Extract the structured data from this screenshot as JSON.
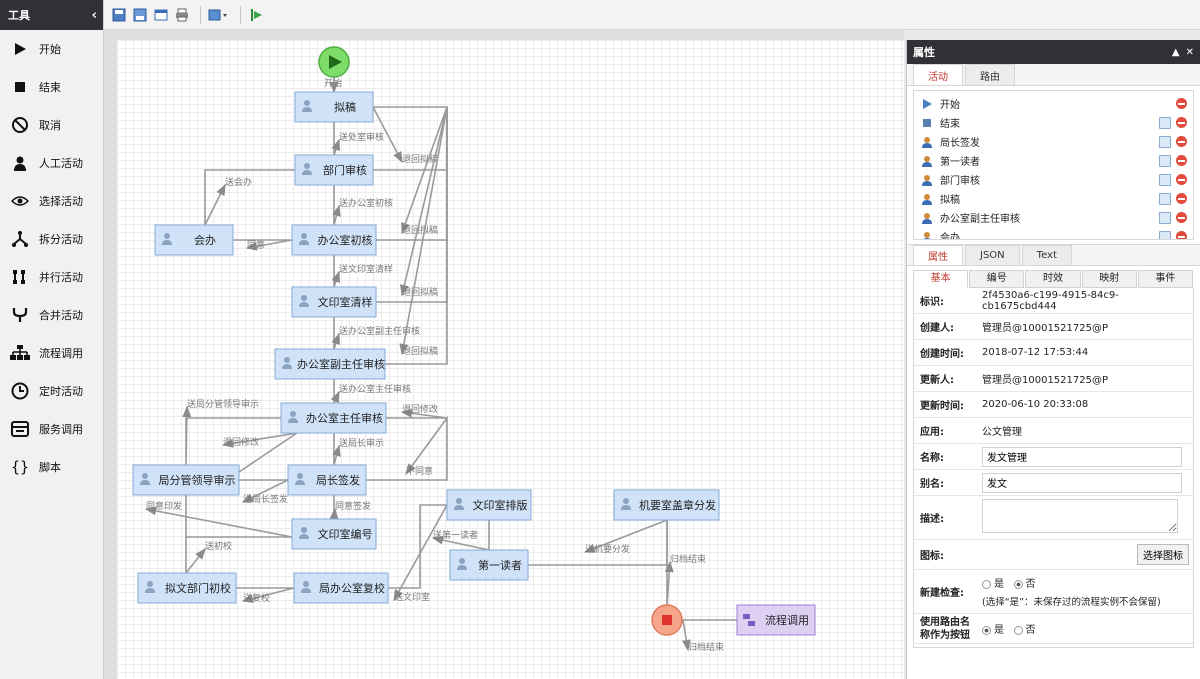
{
  "toolbox": {
    "title": "工具",
    "items": [
      {
        "label": "开始",
        "icon": "play-icon"
      },
      {
        "label": "结束",
        "icon": "stop-icon"
      },
      {
        "label": "取消",
        "icon": "cancel-icon"
      },
      {
        "label": "人工活动",
        "icon": "person-icon"
      },
      {
        "label": "选择活动",
        "icon": "eye-icon"
      },
      {
        "label": "拆分活动",
        "icon": "split-icon"
      },
      {
        "label": "并行活动",
        "icon": "parallel-icon"
      },
      {
        "label": "合并活动",
        "icon": "merge-icon"
      },
      {
        "label": "流程调用",
        "icon": "hierarchy-icon"
      },
      {
        "label": "定时活动",
        "icon": "clock-icon"
      },
      {
        "label": "服务调用",
        "icon": "service-icon"
      },
      {
        "label": "脚本",
        "icon": "script-icon"
      }
    ]
  },
  "flow": {
    "nodes": [
      {
        "label": "拟稿"
      },
      {
        "label": "部门审核"
      },
      {
        "label": "会办"
      },
      {
        "label": "办公室初核"
      },
      {
        "label": "文印室清样"
      },
      {
        "label": "办公室副主任审核"
      },
      {
        "label": "办公室主任审核"
      },
      {
        "label": "局分管领导审示"
      },
      {
        "label": "局长签发"
      },
      {
        "label": "文印室编号"
      },
      {
        "label": "拟文部门初校"
      },
      {
        "label": "局办公室复校"
      },
      {
        "label": "文印室排版"
      },
      {
        "label": "第一读者"
      },
      {
        "label": "机要室盖章分发"
      },
      {
        "label": "流程调用"
      }
    ],
    "start_label": "开始",
    "edge_labels": [
      "送处室审核",
      "退回拟稿",
      "送会办",
      "送办公室初核",
      "退回拟稿",
      "同意",
      "送文印室清样",
      "退回拟稿",
      "送办公室副主任审核",
      "退回拟稿",
      "送办公室主任审核",
      "退回修改",
      "送局分管领导审示",
      "退回修改",
      "送局长审示",
      "送局长签发",
      "不同意",
      "同意印发",
      "同意签发",
      "送初校",
      "送复校",
      "送文印室",
      "送第一读者",
      "送机要分发",
      "归档结束",
      "归档结束"
    ]
  },
  "panel": {
    "title": "属性",
    "top_tabs": [
      "活动",
      "路由"
    ],
    "activities": [
      {
        "name": "开始",
        "kind": "start"
      },
      {
        "name": "结束",
        "kind": "end"
      },
      {
        "name": "局长签发",
        "kind": "person"
      },
      {
        "name": "第一读者",
        "kind": "person"
      },
      {
        "name": "部门审核",
        "kind": "person"
      },
      {
        "name": "拟稿",
        "kind": "person"
      },
      {
        "name": "办公室副主任审核",
        "kind": "person"
      },
      {
        "name": "会办",
        "kind": "person"
      }
    ],
    "mid_tabs": [
      "属性",
      "JSON",
      "Text"
    ],
    "sub_tabs": [
      "基本",
      "编号",
      "时效",
      "映射",
      "事件"
    ],
    "props": {
      "id_label": "标识:",
      "id": "2f4530a6-c199-4915-84c9-cb1675cbd444",
      "creator_label": "创建人:",
      "creator": "管理员@10001521725@P",
      "created_label": "创建时间:",
      "created": "2018-07-12 17:53:44",
      "updater_label": "更新人:",
      "updater": "管理员@10001521725@P",
      "updated_label": "更新时间:",
      "updated": "2020-06-10 20:33:08",
      "app_label": "应用:",
      "app": "公文管理",
      "name_label": "名称:",
      "name": "发文管理",
      "alias_label": "别名:",
      "alias": "发文",
      "desc_label": "描述:",
      "icon_label": "图标:",
      "icon_button": "选择图标",
      "newcheck_label": "新建检查:",
      "yes": "是",
      "no": "否",
      "newcheck_note": "(选择“是”：未保存过的流程实例不会保留)",
      "route_label": "使用路由名称作为按钮",
      "route_yes": "是",
      "route_no": "否"
    }
  }
}
